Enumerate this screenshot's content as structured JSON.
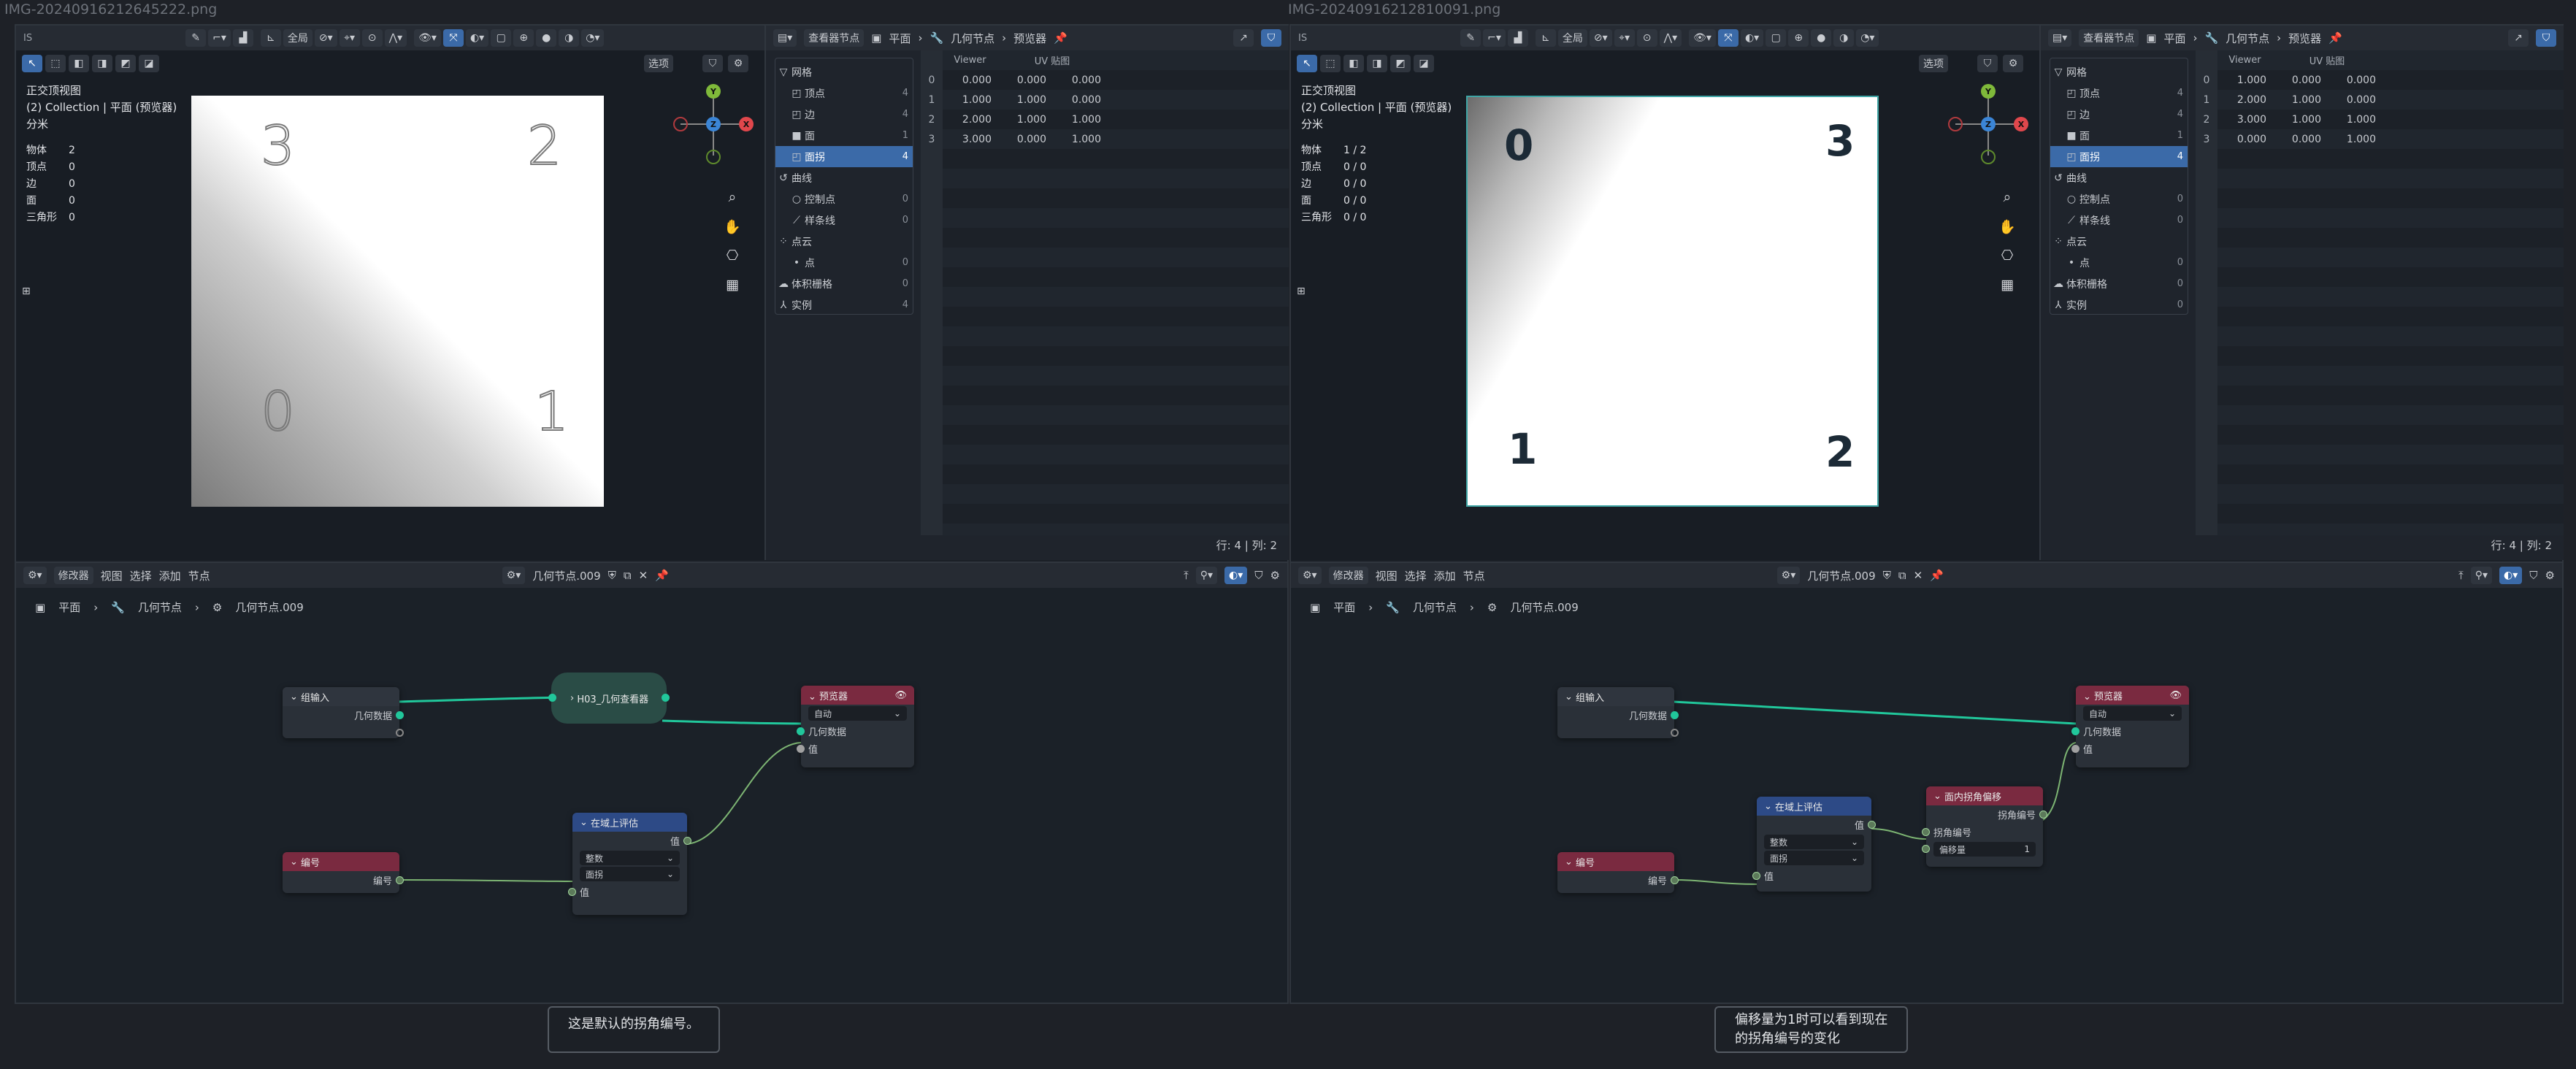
{
  "left": {
    "file_title": "IMG-20240916212645222.png",
    "viewport": {
      "tag": "IS",
      "scope": "全局",
      "options": "选项",
      "view_name": "正交顶视图",
      "collection": "(2) Collection | 平面 (预览器)",
      "unit": "分米",
      "stats": [
        {
          "k": "物体",
          "v": "2"
        },
        {
          "k": "顶点",
          "v": "0"
        },
        {
          "k": "边",
          "v": "0"
        },
        {
          "k": "面",
          "v": "0"
        },
        {
          "k": "三角形",
          "v": "0"
        }
      ],
      "corners": {
        "tl": "3",
        "tr": "2",
        "bl": "0",
        "br": "1"
      }
    },
    "sheet": {
      "header_mode": "查看器节点",
      "crumb_object": "平面",
      "crumb_modifier": "几何节点",
      "crumb_viewer": "预览器",
      "tree": [
        {
          "label": "网格",
          "count": "",
          "icon": "▽",
          "level": 0
        },
        {
          "label": "顶点",
          "count": "4",
          "icon": "◰",
          "level": 1
        },
        {
          "label": "边",
          "count": "4",
          "icon": "◰",
          "level": 1
        },
        {
          "label": "面",
          "count": "1",
          "icon": "■",
          "level": 1
        },
        {
          "label": "面拐",
          "count": "4",
          "icon": "◰",
          "level": 1,
          "sel": true
        },
        {
          "label": "曲线",
          "count": "",
          "icon": "↺",
          "level": 0
        },
        {
          "label": "控制点",
          "count": "0",
          "icon": "○",
          "level": 1
        },
        {
          "label": "样条线",
          "count": "0",
          "icon": "⟋",
          "level": 1
        },
        {
          "label": "点云",
          "count": "",
          "icon": "⁘",
          "level": 0
        },
        {
          "label": "点",
          "count": "0",
          "icon": "•",
          "level": 1
        },
        {
          "label": "体积栅格",
          "count": "0",
          "icon": "☁",
          "level": 0
        },
        {
          "label": "实例",
          "count": "4",
          "icon": "⅄",
          "level": 0
        }
      ],
      "columns": [
        "Viewer",
        "UV 贴图"
      ],
      "rows": [
        [
          "0",
          "0.000",
          "0.000",
          "0.000"
        ],
        [
          "1",
          "1.000",
          "1.000",
          "0.000"
        ],
        [
          "2",
          "2.000",
          "1.000",
          "1.000"
        ],
        [
          "3",
          "3.000",
          "0.000",
          "1.000"
        ]
      ],
      "footer": "行: 4   |   列: 2"
    },
    "node_editor": {
      "editor_type": "修改器",
      "menus": [
        "视图",
        "选择",
        "添加",
        "节点"
      ],
      "tree_name": "几何节点.009",
      "crumbs": [
        "平面",
        "几何节点",
        "几何节点.009"
      ],
      "nodes": {
        "group_input": {
          "title": "组输入",
          "out": "几何数据"
        },
        "group_node": {
          "title": "H03_几何查看器"
        },
        "viewer": {
          "title": "预览器",
          "mode": "自动",
          "in1": "几何数据",
          "in2": "值"
        },
        "index": {
          "title": "编号",
          "out": "编号"
        },
        "eval_domain": {
          "title": "在域上评估",
          "out": "值",
          "type": "整数",
          "domain": "面拐",
          "in": "值"
        }
      }
    },
    "caption": "这是默认的拐角编号。"
  },
  "right": {
    "file_title": "IMG-20240916212810091.png",
    "viewport": {
      "tag": "IS",
      "scope": "全局",
      "options": "选项",
      "view_name": "正交顶视图",
      "collection": "(2) Collection | 平面 (预览器)",
      "unit": "分米",
      "stats": [
        {
          "k": "物体",
          "v": "1 / 2"
        },
        {
          "k": "顶点",
          "v": "0 / 0"
        },
        {
          "k": "边",
          "v": "0 / 0"
        },
        {
          "k": "面",
          "v": "0 / 0"
        },
        {
          "k": "三角形",
          "v": "0 / 0"
        }
      ],
      "corners": {
        "tl": "0",
        "tr": "3",
        "bl": "1",
        "br": "2"
      }
    },
    "sheet": {
      "header_mode": "查看器节点",
      "crumb_object": "平面",
      "crumb_modifier": "几何节点",
      "crumb_viewer": "预览器",
      "tree": [
        {
          "label": "网格",
          "count": "",
          "icon": "▽",
          "level": 0
        },
        {
          "label": "顶点",
          "count": "4",
          "icon": "◰",
          "level": 1
        },
        {
          "label": "边",
          "count": "4",
          "icon": "◰",
          "level": 1
        },
        {
          "label": "面",
          "count": "1",
          "icon": "■",
          "level": 1
        },
        {
          "label": "面拐",
          "count": "4",
          "icon": "◰",
          "level": 1,
          "sel": true
        },
        {
          "label": "曲线",
          "count": "",
          "icon": "↺",
          "level": 0
        },
        {
          "label": "控制点",
          "count": "0",
          "icon": "○",
          "level": 1
        },
        {
          "label": "样条线",
          "count": "0",
          "icon": "⟋",
          "level": 1
        },
        {
          "label": "点云",
          "count": "",
          "icon": "⁘",
          "level": 0
        },
        {
          "label": "点",
          "count": "0",
          "icon": "•",
          "level": 1
        },
        {
          "label": "体积栅格",
          "count": "0",
          "icon": "☁",
          "level": 0
        },
        {
          "label": "实例",
          "count": "0",
          "icon": "⅄",
          "level": 0
        }
      ],
      "columns": [
        "Viewer",
        "UV 贴图"
      ],
      "rows": [
        [
          "0",
          "1.000",
          "0.000",
          "0.000"
        ],
        [
          "1",
          "2.000",
          "1.000",
          "0.000"
        ],
        [
          "2",
          "3.000",
          "1.000",
          "1.000"
        ],
        [
          "3",
          "0.000",
          "0.000",
          "1.000"
        ]
      ],
      "footer": "行: 4   |   列: 2"
    },
    "node_editor": {
      "editor_type": "修改器",
      "menus": [
        "视图",
        "选择",
        "添加",
        "节点"
      ],
      "tree_name": "几何节点.009",
      "crumbs": [
        "平面",
        "几何节点",
        "几何节点.009"
      ],
      "nodes": {
        "group_input": {
          "title": "组输入",
          "out": "几何数据"
        },
        "viewer": {
          "title": "预览器",
          "mode": "自动",
          "in1": "几何数据",
          "in2": "值"
        },
        "index": {
          "title": "编号",
          "out": "编号"
        },
        "eval_domain": {
          "title": "在域上评估",
          "out": "值",
          "type": "整数",
          "domain": "面拐",
          "in": "值"
        },
        "offset": {
          "title": "面内拐角偏移",
          "out": "拐角编号",
          "in1": "拐角编号",
          "in2_label": "偏移量",
          "in2_value": "1"
        }
      }
    },
    "caption_line1": "偏移量为1时可以看到现在",
    "caption_line2": "的拐角编号的变化"
  },
  "colors": {
    "accent": "#3b6aa8",
    "geo_link": "#21c79b",
    "viewer_header": "#7a2a40",
    "index_header": "#7a2a40",
    "eval_header": "#2d4a86",
    "offset_header": "#7a2a40"
  }
}
